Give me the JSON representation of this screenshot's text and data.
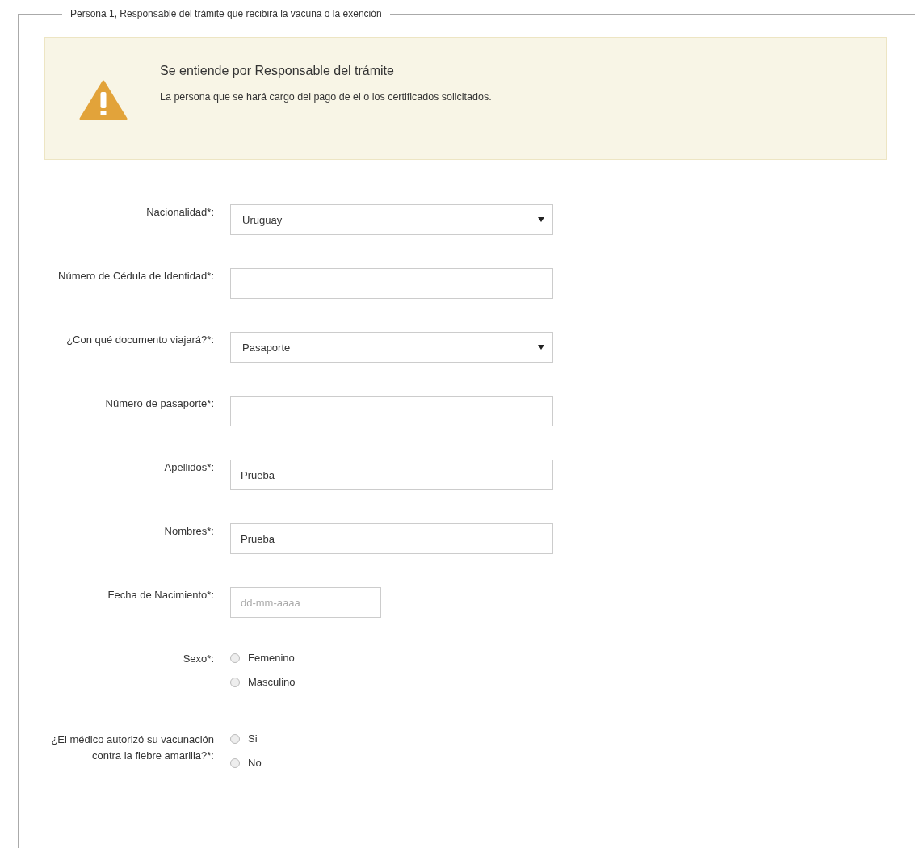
{
  "legend": "Persona 1, Responsable del trámite que recibirá la vacuna o la exención",
  "alert": {
    "title": "Se entiende por Responsable del trámite",
    "text": "La persona que se hará cargo del pago de el o los certificados solicitados."
  },
  "fields": [
    {
      "kind": "select",
      "label": "Nacionalidad*:",
      "value": "Uruguay"
    },
    {
      "kind": "text",
      "label": "Número de Cédula de Identidad*:"
    },
    {
      "kind": "select",
      "label": "¿Con qué documento viajará?*:",
      "value": "Pasaporte"
    },
    {
      "kind": "text",
      "label": "Número de pasaporte*:"
    },
    {
      "kind": "text",
      "label": "Apellidos*:",
      "value": "Prueba"
    },
    {
      "kind": "text",
      "label": "Nombres*:",
      "value": "Prueba"
    },
    {
      "kind": "date",
      "label": "Fecha de Nacimiento*:",
      "placeholder": "dd-mm-aaaa"
    },
    {
      "kind": "radio",
      "label": "Sexo*:",
      "options": [
        {
          "label": "Femenino",
          "selected": false
        },
        {
          "label": "Masculino",
          "selected": false
        }
      ]
    },
    {
      "kind": "radio",
      "label": "¿El médico autorizó su vacunación contra la fiebre amarilla?*:",
      "options": [
        {
          "label": "Si",
          "selected": false
        },
        {
          "label": "No",
          "selected": false
        }
      ]
    }
  ]
}
